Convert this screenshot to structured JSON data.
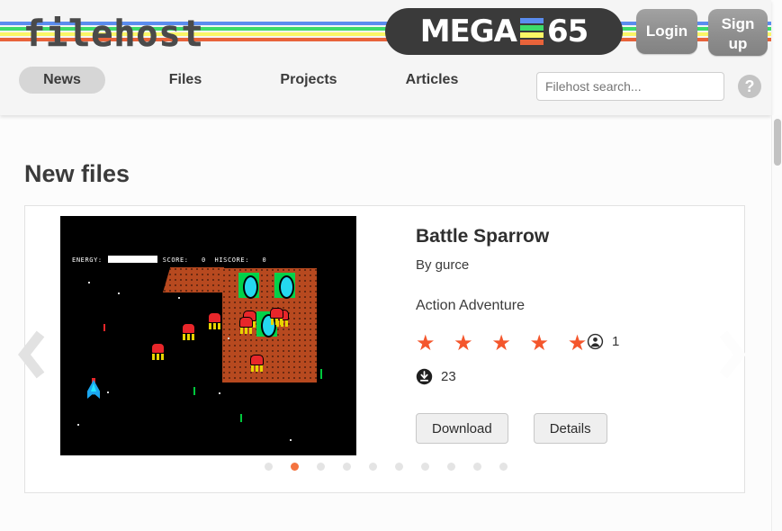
{
  "brand": {
    "wordmark": "filehost",
    "logo_text_1": "MEGA",
    "logo_text_2": "65"
  },
  "colors": {
    "stripe_blue": "#5b8def",
    "stripe_green": "#3ddb6a",
    "stripe_yellow": "#fbf665",
    "stripe_orange": "#e8633a",
    "accent_orange": "#f4562c",
    "dot_active": "#f4733f",
    "header_bg": "#f5f5f5",
    "page_bg": "#fcfcfc",
    "logo_pill": "#3a3a3a"
  },
  "header": {
    "login_label": "Login",
    "signup_label": "Sign\nup",
    "signup_line1": "Sign",
    "signup_line2": "up",
    "nav": [
      {
        "label": "News",
        "active": true
      },
      {
        "label": "Files",
        "active": false
      },
      {
        "label": "Projects",
        "active": false
      },
      {
        "label": "Articles",
        "active": false
      }
    ],
    "search": {
      "value": "",
      "placeholder": "Filehost search..."
    },
    "help_label": "?"
  },
  "main": {
    "page_title": "New files",
    "card": {
      "title": "Battle Sparrow",
      "author": "By gurce",
      "genre": "Action Adventure",
      "stars": "★ ★ ★ ★ ★",
      "star_count": 5,
      "viewer_count": "1",
      "download_count": "23",
      "download_label": "Download",
      "details_label": "Details",
      "thumbnail": {
        "hud_energy_label": "ENERGY:",
        "hud_score_label": "SCORE:",
        "hud_score_value": "0",
        "hud_hiscore_label": "HISCORE:",
        "hud_hiscore_value": "0"
      }
    },
    "carousel": {
      "prev_label": "Previous",
      "next_label": "Next",
      "total_dots": 10,
      "active_dot_index": 1
    }
  }
}
